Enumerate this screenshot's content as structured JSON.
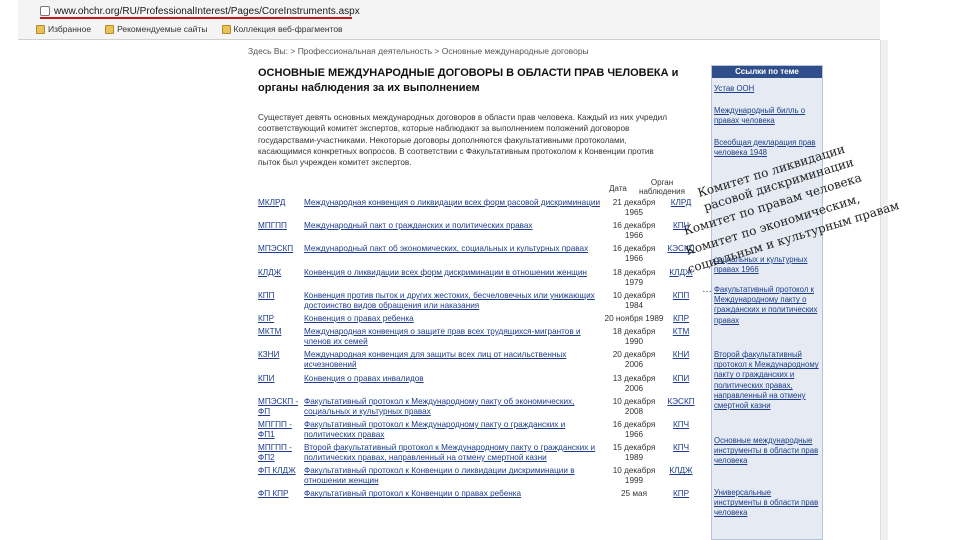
{
  "browser": {
    "url": "www.ohchr.org/RU/ProfessionalInterest/Pages/CoreInstruments.aspx",
    "favorites": [
      "Избранное",
      "Рекомендуемые сайты",
      "Коллекция веб-фрагментов"
    ]
  },
  "breadcrumb": "Здесь Вы: > Профессиональная деятельность > Основные международные договоры",
  "page": {
    "title": "ОСНОВНЫЕ МЕЖДУНАРОДНЫЕ ДОГОВОРЫ В ОБЛАСТИ ПРАВ ЧЕЛОВЕКА и органы наблюдения за их выполнением",
    "intro": "Существует девять основных международных договоров в области прав человека. Каждый из них учредил соответствующий комитет экспертов, которые наблюдают за выполнением положений договоров государствами-участниками. Некоторые договоры дополняются факультативными протоколами, касающимися конкретных вопросов. В соответствии с Факультативным протоколом к Конвенции против пыток был учрежден комитет экспертов.",
    "col_date": "Дата",
    "col_body": "Орган наблюдения"
  },
  "treaties": [
    {
      "abbr": "МКЛРД",
      "name": "Международная конвенция о ликвидации всех форм расовой дискриминации",
      "date": "21 декабря 1965",
      "body": "КЛРД"
    },
    {
      "abbr": "МПГПП",
      "name": "Международный пакт о гражданских и политических правах",
      "date": "16 декабря 1966",
      "body": "КПЧ"
    },
    {
      "abbr": "МПЭСКП",
      "name": "Международный пакт об экономических, социальных и культурных правах",
      "date": "16 декабря 1966",
      "body": "КЭСКП"
    },
    {
      "abbr": "КЛДЖ",
      "name": "Конвенция о ликвидации всех форм дискриминации в отношении женщин",
      "date": "18 декабря 1979",
      "body": "КЛДЖ"
    },
    {
      "abbr": "КПП",
      "name": "Конвенция против пыток и других жестоких, бесчеловечных или унижающих достоинство видов обращения или наказания",
      "date": "10 декабря 1984",
      "body": "КПП"
    },
    {
      "abbr": "КПР",
      "name": "Конвенция о правах ребенка",
      "date": "20 ноября 1989",
      "body": "КПР"
    },
    {
      "abbr": "МКТМ",
      "name": "Международная конвенция о защите прав всех трудящихся-мигрантов и членов их семей",
      "date": "18 декабря 1990",
      "body": "КТМ"
    },
    {
      "abbr": "КЗНИ",
      "name": "Международная конвенция для защиты всех лиц от насильственных исчезновений",
      "date": "20 декабря 2006",
      "body": "КНИ"
    },
    {
      "abbr": "КПИ",
      "name": "Конвенция о правах инвалидов",
      "date": "13 декабря 2006",
      "body": "КПИ"
    },
    {
      "abbr": "МПЭСКП - ФП",
      "name": "Факультативный протокол к Международному пакту об экономических, социальных и культурных правах",
      "date": "10 декабря 2008",
      "body": "КЭСКП"
    },
    {
      "abbr": "МПГПП - ФП1",
      "name": "Факультативный протокол к Международному пакту о гражданских и политических правах",
      "date": "16 декабря 1966",
      "body": "КПЧ"
    },
    {
      "abbr": "МПГПП - ФП2",
      "name": "Второй факультативный протокол к Международному пакту о гражданских и политических правах, направленный на отмену смертной казни",
      "date": "15 декабря 1989",
      "body": "КПЧ"
    },
    {
      "abbr": "ФП КЛДЖ",
      "name": "Факультативный протокол к Конвенции о ликвидации дискриминации в отношении женщин",
      "date": "10 декабря 1999",
      "body": "КЛДЖ"
    },
    {
      "abbr": "ФП КПР",
      "name": "Факультативный протокол к Конвенции о правах ребенка",
      "date": "25 мая",
      "body": "КПР"
    }
  ],
  "sidebar": {
    "heading": "Ссылки по теме",
    "links": [
      "Устав ООН",
      "Международный билль о правах человека",
      "Всеобщая декларация прав человека 1948",
      "",
      "",
      "",
      "социальных и культурных правах 1966",
      "Факультативный протокол к Международному пакту о гражданских и политических правах",
      "Второй факультативный протокол к Международному пакту о гражданских и политических правах, направленный на отмену смертной казни",
      "Основные международные инструменты в области прав человека",
      "Универсальные инструменты в области прав человека"
    ]
  },
  "annotations": [
    "Комитет по ликвидации",
    "расовой дискриминации",
    "Комитет по правам человека",
    "Комитет по экономическим,",
    "социальным и культурным правам"
  ],
  "ellipsis": "…"
}
